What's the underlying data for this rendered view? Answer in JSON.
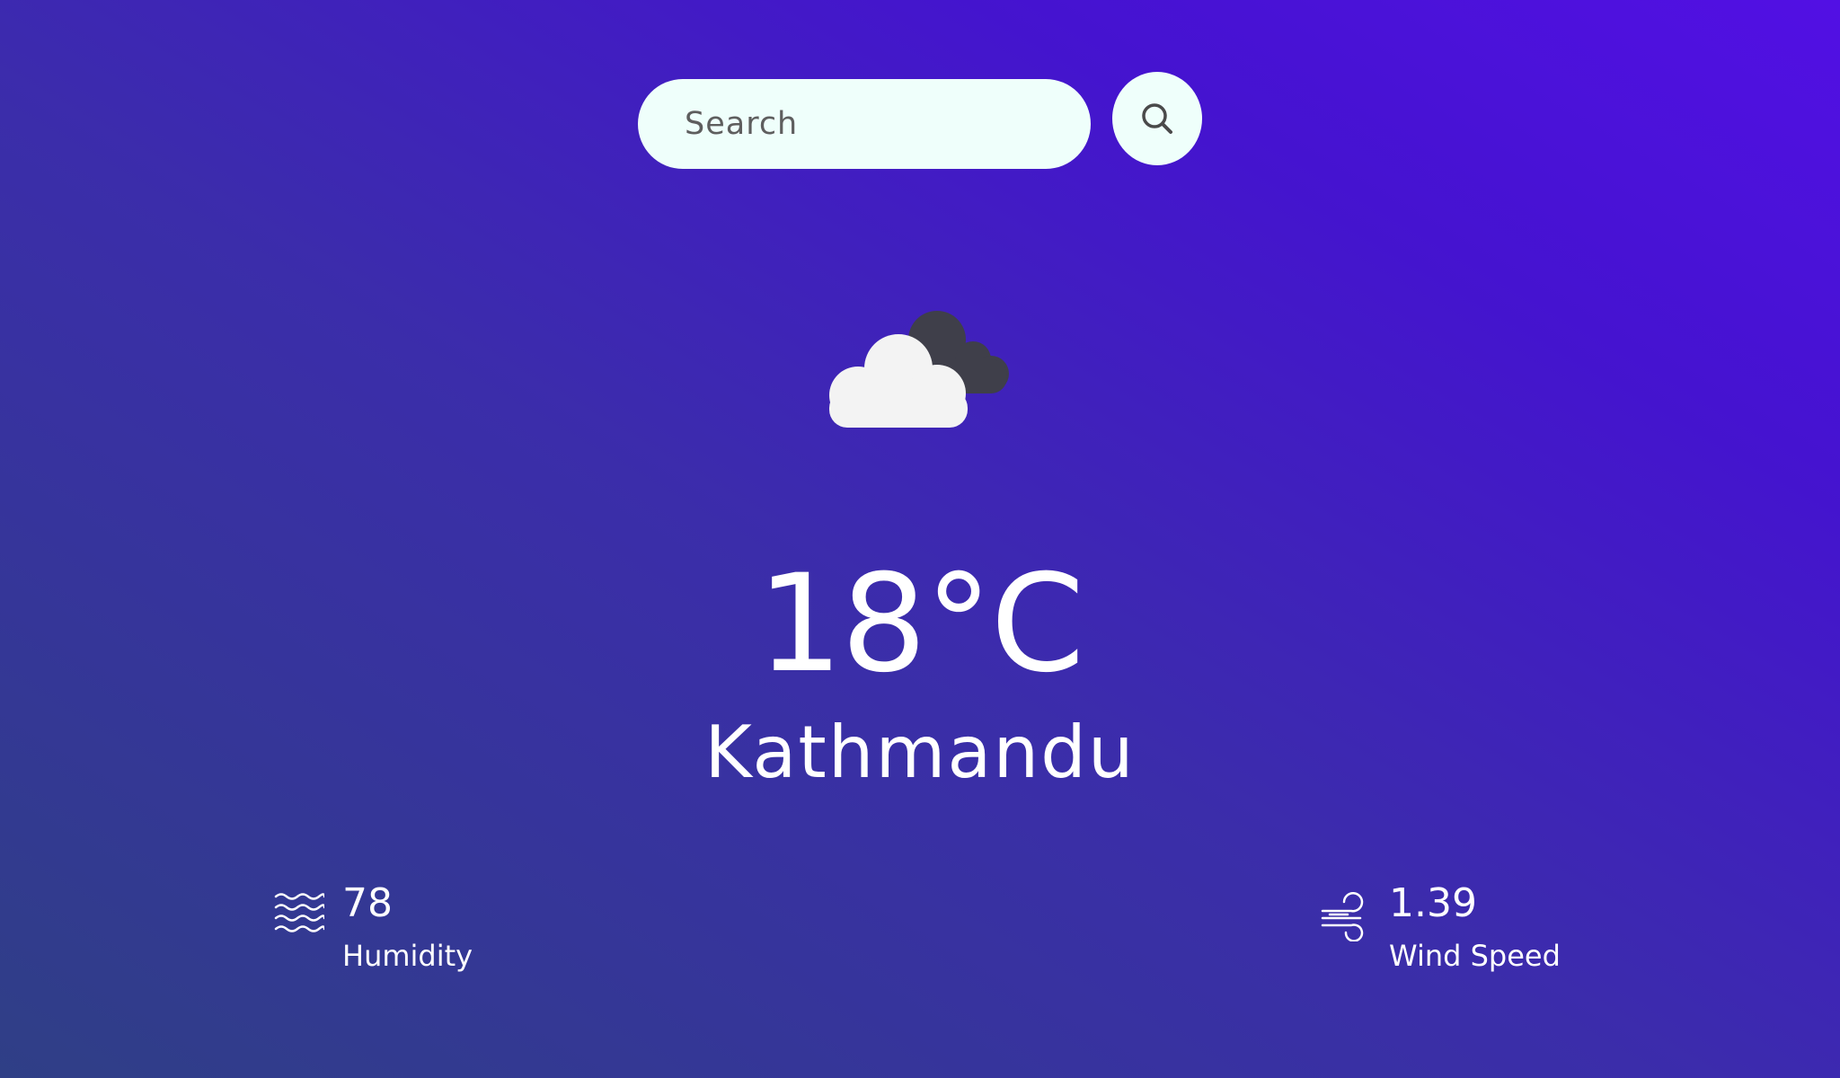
{
  "search": {
    "placeholder": "Search",
    "value": "",
    "button_icon": "search-icon"
  },
  "weather": {
    "icon": "cloudy-icon",
    "temperature": "18°C",
    "city": "Kathmandu"
  },
  "details": {
    "humidity": {
      "icon": "humidity-icon",
      "value": "78",
      "label": "Humidity"
    },
    "wind": {
      "icon": "wind-icon",
      "value": "1.39",
      "label": "Wind Speed"
    }
  },
  "colors": {
    "background_start": "#2f3f86",
    "background_end": "#5210e4",
    "input_background": "#effffb",
    "text": "#ffffff"
  }
}
